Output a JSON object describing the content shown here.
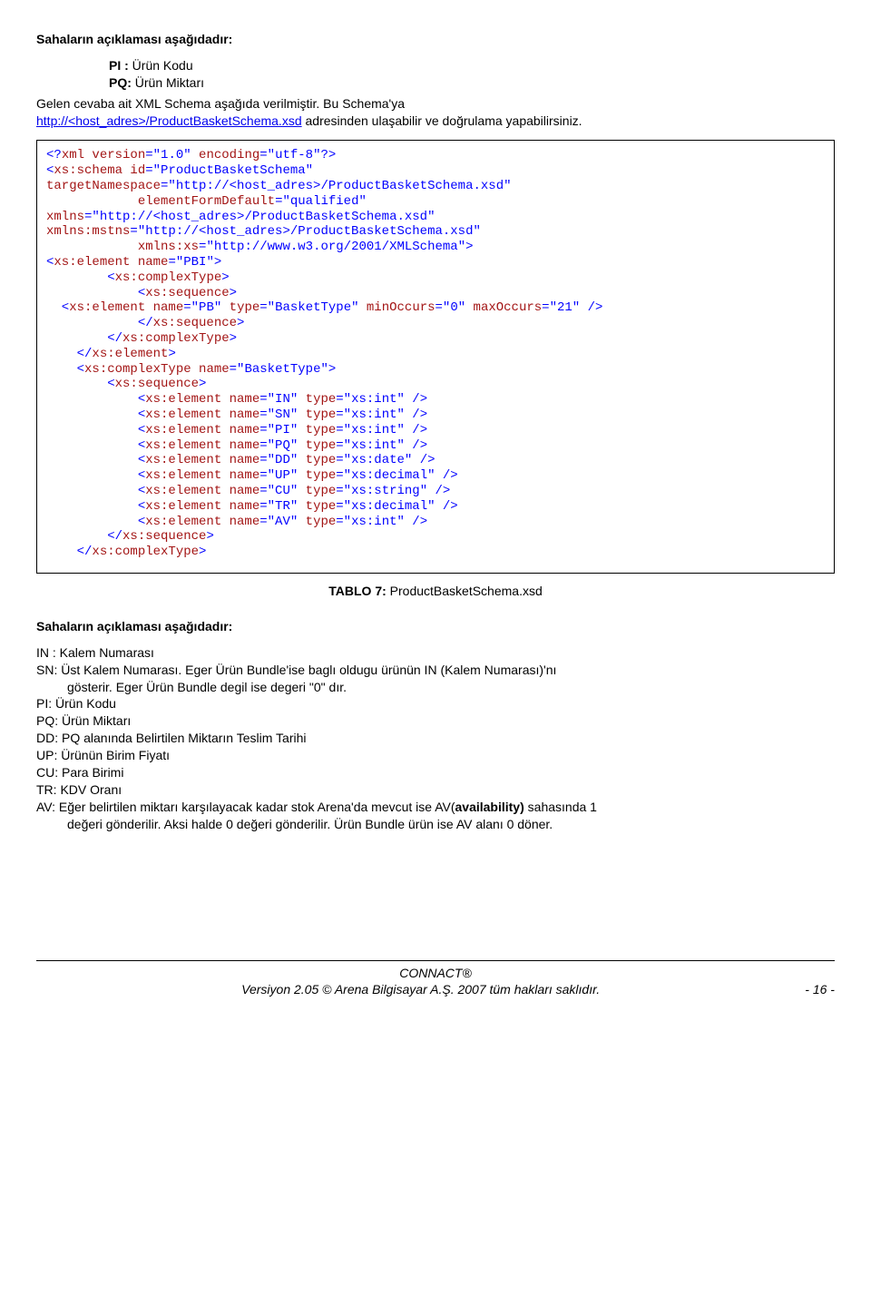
{
  "heading1": "Sahaların açıklaması aşağıdadır:",
  "fields_top": {
    "pi_label": "PI :",
    "pi_text": " Ürün Kodu",
    "pq_label": "PQ:",
    "pq_text": " Ürün Miktarı"
  },
  "para1_pre": "Gelen cevaba ait XML Schema aşağıda verilmiştir. Bu Schema'ya ",
  "para1_link": "http://<host_adres>/ProductBasketSchema.xsd",
  "para1_post": " adresinden ulaşabilir ve doğrulama yapabilirsiniz.",
  "code": {
    "l01a": "<?",
    "l01b": "xml version",
    "l01c": "=\"1.0\" ",
    "l01d": "encoding",
    "l01e": "=\"utf-8\"?>",
    "l02a": "<",
    "l02b": "xs:schema id",
    "l02c": "=\"ProductBasketSchema\"",
    "l03a": "targetNamespace",
    "l03b": "=\"http://<host_adres>/ProductBasketSchema.xsd\"",
    "l04a": "            ",
    "l04b": "elementFormDefault",
    "l04c": "=\"qualified\"",
    "l05a": "xmlns",
    "l05b": "=\"http://<host_adres>/ProductBasketSchema.xsd\"",
    "l06a": "xmlns:mstns",
    "l06b": "=\"http://<host_adres>/ProductBasketSchema.xsd\"",
    "l07a": "            ",
    "l07b": "xmlns:xs",
    "l07c": "=\"http://www.w3.org/2001/XMLSchema\">",
    "l08a": "<",
    "l08b": "xs:element name",
    "l08c": "=\"PBI\">",
    "l09a": "        <",
    "l09b": "xs:complexType",
    "l09c": ">",
    "l10a": "            <",
    "l10b": "xs:sequence",
    "l10c": ">",
    "l11a": "  <",
    "l11b": "xs:element name",
    "l11c": "=\"PB\" ",
    "l11d": "type",
    "l11e": "=\"BasketType\" ",
    "l11f": "minOccurs",
    "l11g": "=\"0\" ",
    "l11h": "maxOccurs",
    "l11i": "=\"21\" />",
    "l12a": "            </",
    "l12b": "xs:sequence",
    "l12c": ">",
    "l13a": "        </",
    "l13b": "xs:complexType",
    "l13c": ">",
    "l14a": "    </",
    "l14b": "xs:element",
    "l14c": ">",
    "l15a": "    <",
    "l15b": "xs:complexType name",
    "l15c": "=\"BasketType\">",
    "l16a": "        <",
    "l16b": "xs:sequence",
    "l16c": ">",
    "l17a": "            <",
    "l17b": "xs:element name",
    "l17c": "=\"IN\" ",
    "l17d": "type",
    "l17e": "=\"xs:int\" />",
    "l18a": "            <",
    "l18b": "xs:element name",
    "l18c": "=\"SN\" ",
    "l18d": "type",
    "l18e": "=\"xs:int\" />",
    "l19a": "            <",
    "l19b": "xs:element name",
    "l19c": "=\"PI\" ",
    "l19d": "type",
    "l19e": "=\"xs:int\" />",
    "l20a": "            <",
    "l20b": "xs:element name",
    "l20c": "=\"PQ\" ",
    "l20d": "type",
    "l20e": "=\"xs:int\" />",
    "l21a": "            <",
    "l21b": "xs:element name",
    "l21c": "=\"DD\" ",
    "l21d": "type",
    "l21e": "=\"xs:date\" />",
    "l22a": "            <",
    "l22b": "xs:element name",
    "l22c": "=\"UP\" ",
    "l22d": "type",
    "l22e": "=\"xs:decimal\" />",
    "l23a": "            <",
    "l23b": "xs:element name",
    "l23c": "=\"CU\" ",
    "l23d": "type",
    "l23e": "=\"xs:string\" />",
    "l24a": "            <",
    "l24b": "xs:element name",
    "l24c": "=\"TR\" ",
    "l24d": "type",
    "l24e": "=\"xs:decimal\" />",
    "l25a": "            <",
    "l25b": "xs:element name",
    "l25c": "=\"AV\" ",
    "l25d": "type",
    "l25e": "=\"xs:int\" />",
    "l26a": "        </",
    "l26b": "xs:sequence",
    "l26c": ">",
    "l27a": "    </",
    "l27b": "xs:complexType",
    "l27c": ">"
  },
  "caption_label": "TABLO 7: ",
  "caption_text": "ProductBasketSchema.xsd",
  "heading2": "Sahaların açıklaması aşağıdadır:",
  "defs": {
    "in": "IN : Kalem Numarası",
    "sn": "SN: Üst Kalem Numarası. Eger Ürün Bundle'ise baglı oldugu ürünün IN (Kalem Numarası)'nı",
    "sn2": "gösterir. Eger Ürün Bundle degil ise degeri \"0\" dır.",
    "pi": "PI:  Ürün Kodu",
    "pq": "PQ: Ürün Miktarı",
    "dd": "DD: PQ alanında Belirtilen Miktarın Teslim Tarihi",
    "up": "UP: Ürünün Birim Fiyatı",
    "cu": "CU: Para Birimi",
    "tr": "TR: KDV Oranı",
    "av1a": "AV: Eğer belirtilen miktarı karşılayacak kadar stok Arena'da mevcut ise AV(",
    "av1b": "availability) ",
    "av1c": "sahasında 1",
    "av2": "değeri gönderilir. Aksi halde 0 değeri gönderilir. Ürün Bundle ürün ise AV alanı 0 döner."
  },
  "footer": {
    "l1": "CONNACT®",
    "l2": "Versiyon 2.05 © Arena Bilgisayar A.Ş. 2007 tüm hakları saklıdır.",
    "page": "- 16 -"
  }
}
